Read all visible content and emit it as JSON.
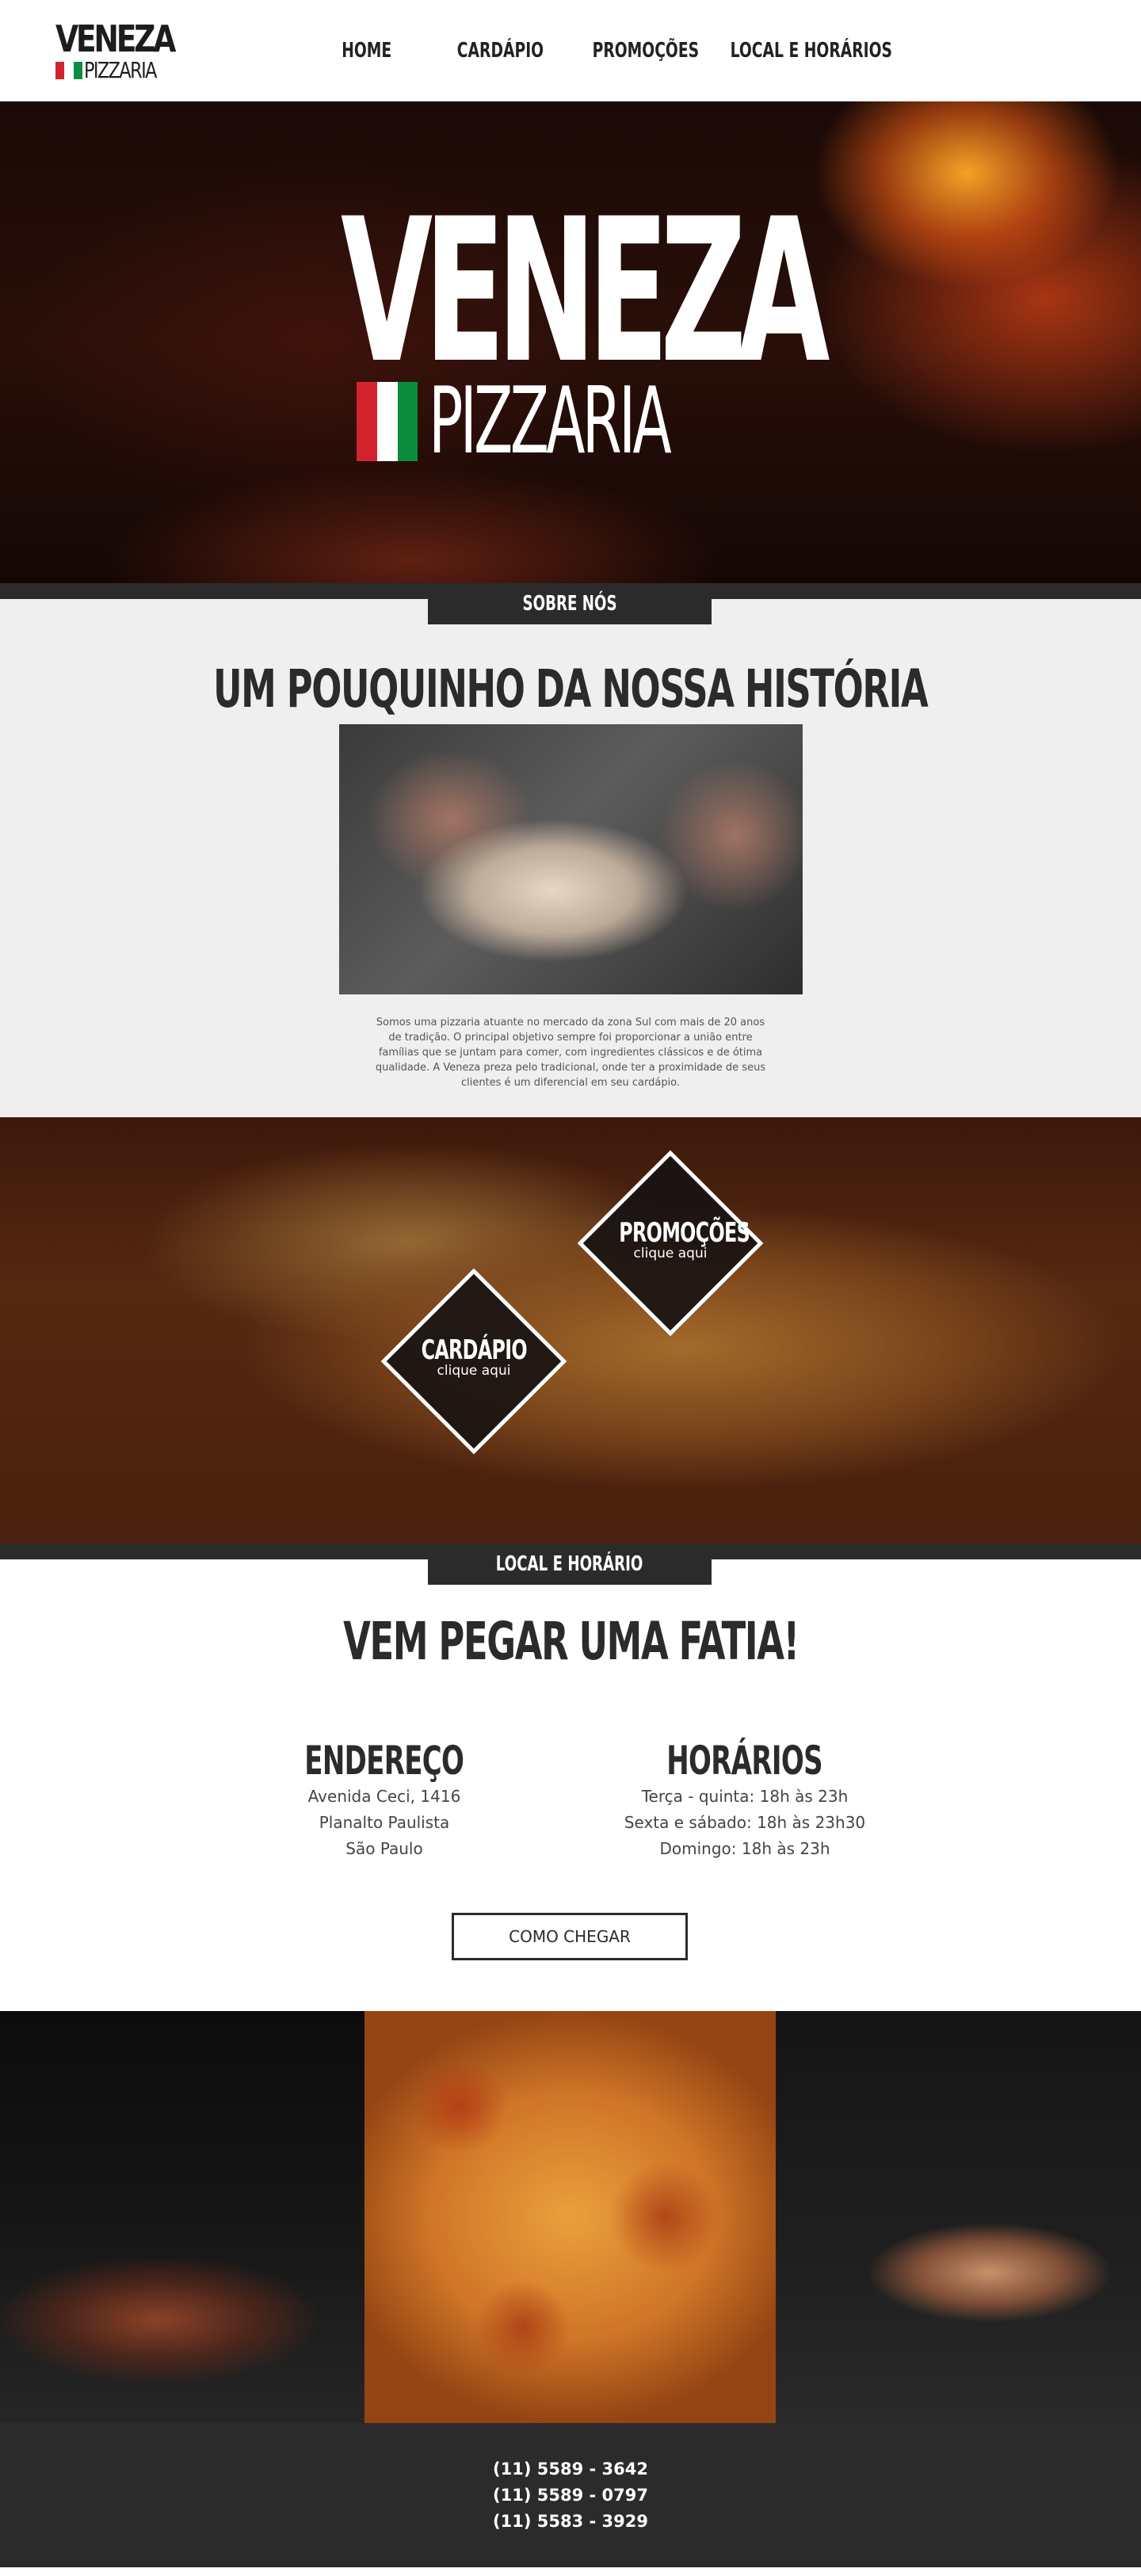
{
  "header": {
    "logo_main": "VENEZA",
    "logo_sub": "PIZZARIA",
    "nav": [
      {
        "label": "HOME"
      },
      {
        "label": "CARDÁPIO"
      },
      {
        "label": "PROMOÇÕES"
      },
      {
        "label": "LOCAL E HORÁRIOS"
      }
    ]
  },
  "hero": {
    "title": "VENEZA",
    "subtitle": "PIZZARIA"
  },
  "flag_colors": [
    "#d2232f",
    "#ffffff",
    "#0b8c3e"
  ],
  "about": {
    "tab": "SOBRE NÓS",
    "title": "UM POUQUINHO DA NOSSA HISTÓRIA",
    "text": "Somos uma pizzaria atuante no mercado da zona Sul com mais de 20 anos de tradição. O principal objetivo sempre foi proporcionar a união entre famílias que se juntam para comer, com ingredientes clássicos e de ótima qualidade. A Veneza preza pelo tradicional, onde ter a proximidade de seus clientes é um diferencial em seu cardápio."
  },
  "promo": {
    "promocoes_title": "PROMOÇÕES",
    "promocoes_sub": "clique aqui",
    "cardapio_title": "CARDÁPIO",
    "cardapio_sub": "clique aqui"
  },
  "local": {
    "tab": "LOCAL E HORÁRIO",
    "title": "VEM PEGAR UMA FATIA!",
    "address_title": "ENDEREÇO",
    "address_lines": [
      "Avenida Ceci, 1416",
      "Planalto Paulista",
      "São Paulo"
    ],
    "hours_title": "HORÁRIOS",
    "hours_lines": [
      "Terça - quinta: 18h às 23h",
      "Sexta e sábado: 18h às 23h30",
      "Domingo: 18h às 23h"
    ],
    "button": "COMO CHEGAR"
  },
  "footer": {
    "phones": [
      "(11) 5589 - 3642",
      "(11) 5589 - 0797",
      "(11) 5583 - 3929"
    ]
  },
  "colors": {
    "dark": "#2b2b2b",
    "about_bg": "#efefef"
  }
}
